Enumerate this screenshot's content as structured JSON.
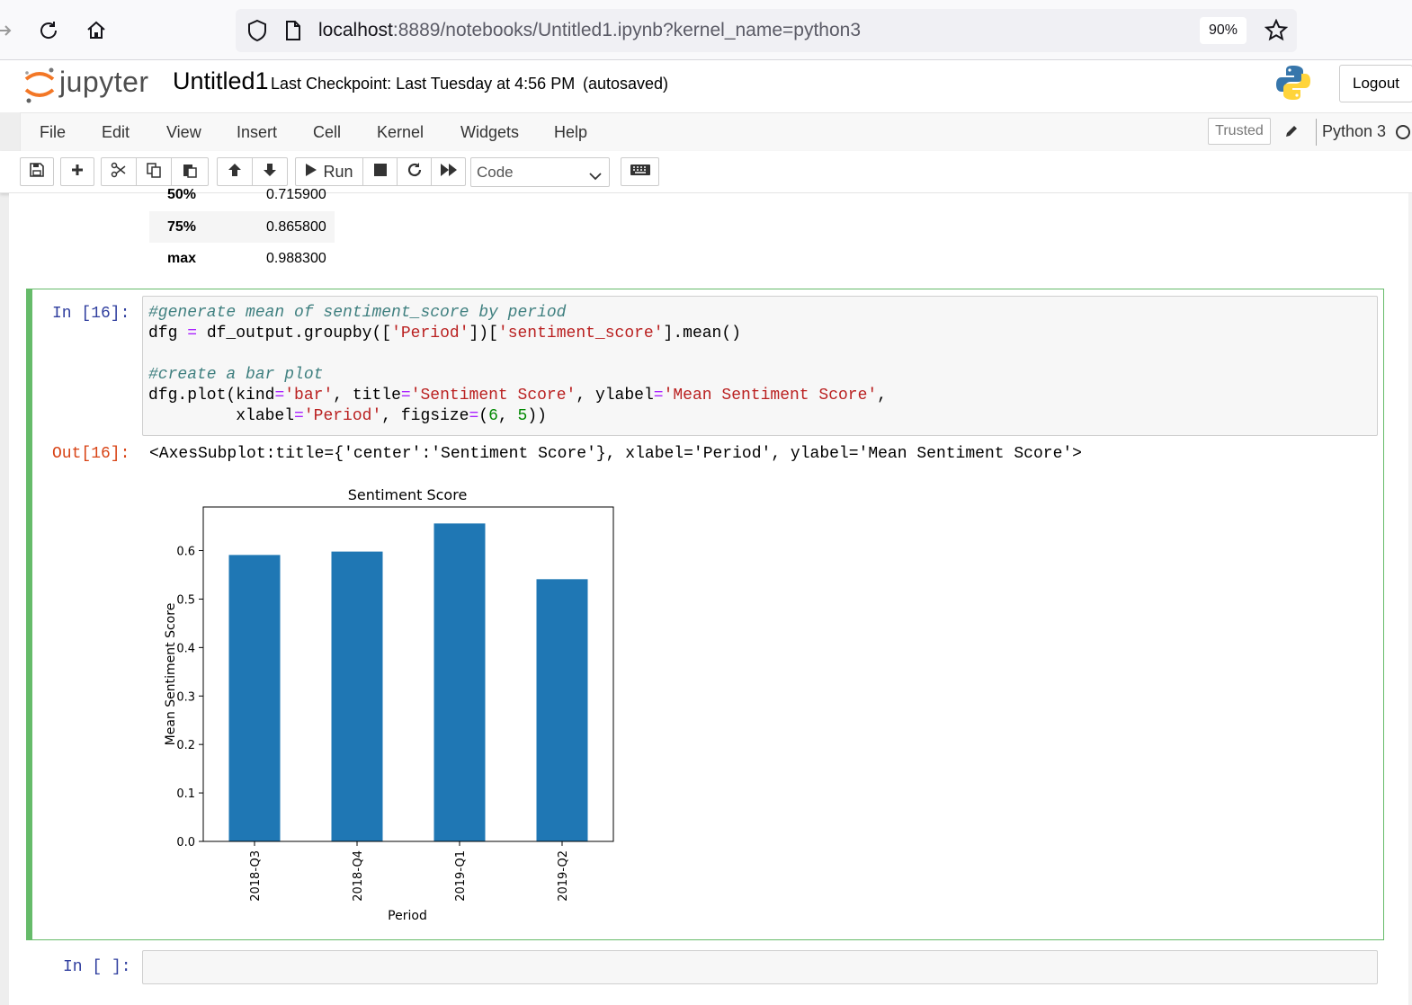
{
  "browser": {
    "url_host": "localhost",
    "url_rest": ":8889/notebooks/Untitled1.ipynb?kernel_name=python3",
    "zoom": "90%"
  },
  "header": {
    "logo_text": "jupyter",
    "notebook_title": "Untitled1",
    "checkpoint": "Last Checkpoint: Last Tuesday at 4:56 PM",
    "autosaved": "(autosaved)",
    "logout_label": "Logout"
  },
  "menubar": {
    "items": [
      "File",
      "Edit",
      "View",
      "Insert",
      "Cell",
      "Kernel",
      "Widgets",
      "Help"
    ],
    "trusted": "Trusted",
    "kernel": "Python 3"
  },
  "toolbar": {
    "run_label": "Run",
    "cell_type": "Code"
  },
  "stats": {
    "rows": [
      {
        "label": "50%",
        "value": "0.715900"
      },
      {
        "label": "75%",
        "value": "0.865800"
      },
      {
        "label": "max",
        "value": "0.988300"
      }
    ]
  },
  "cell16": {
    "in_prompt": "In [16]:",
    "out_prompt": "Out[16]:",
    "code": {
      "l1": "#generate mean of sentiment_score by period",
      "l2_a": "dfg ",
      "l2_op": "=",
      "l2_b": " df_output.groupby([",
      "l2_s1": "'Period'",
      "l2_c": "])[",
      "l2_s2": "'sentiment_score'",
      "l2_d": "].mean()",
      "l4": "#create a bar plot",
      "l5_a": "dfg.plot(kind",
      "l5_op1": "=",
      "l5_s1": "'bar'",
      "l5_b": ", title",
      "l5_op2": "=",
      "l5_s2": "'Sentiment Score'",
      "l5_c": ", ylabel",
      "l5_op3": "=",
      "l5_s3": "'Mean Sentiment Score'",
      "l5_d": ",",
      "l6_a": "         xlabel",
      "l6_op1": "=",
      "l6_s1": "'Period'",
      "l6_b": ", figsize",
      "l6_op2": "=",
      "l6_c": "(",
      "l6_n1": "6",
      "l6_d": ", ",
      "l6_n2": "5",
      "l6_e": "))"
    },
    "output_text": "<AxesSubplot:title={'center':'Sentiment Score'}, xlabel='Period', ylabel='Mean Sentiment Score'>"
  },
  "empty_cell": {
    "in_prompt": "In [ ]:"
  },
  "chart_data": {
    "type": "bar",
    "title": "Sentiment Score",
    "xlabel": "Period",
    "ylabel": "Mean Sentiment Score",
    "categories": [
      "2018-Q3",
      "2018-Q4",
      "2019-Q1",
      "2019-Q2"
    ],
    "values": [
      0.591,
      0.598,
      0.656,
      0.541
    ],
    "ylim": [
      0,
      0.69
    ],
    "yticks": [
      "0.0",
      "0.1",
      "0.2",
      "0.3",
      "0.4",
      "0.5",
      "0.6"
    ],
    "bar_color": "#1f77b4",
    "grid": false,
    "legend": "none"
  }
}
